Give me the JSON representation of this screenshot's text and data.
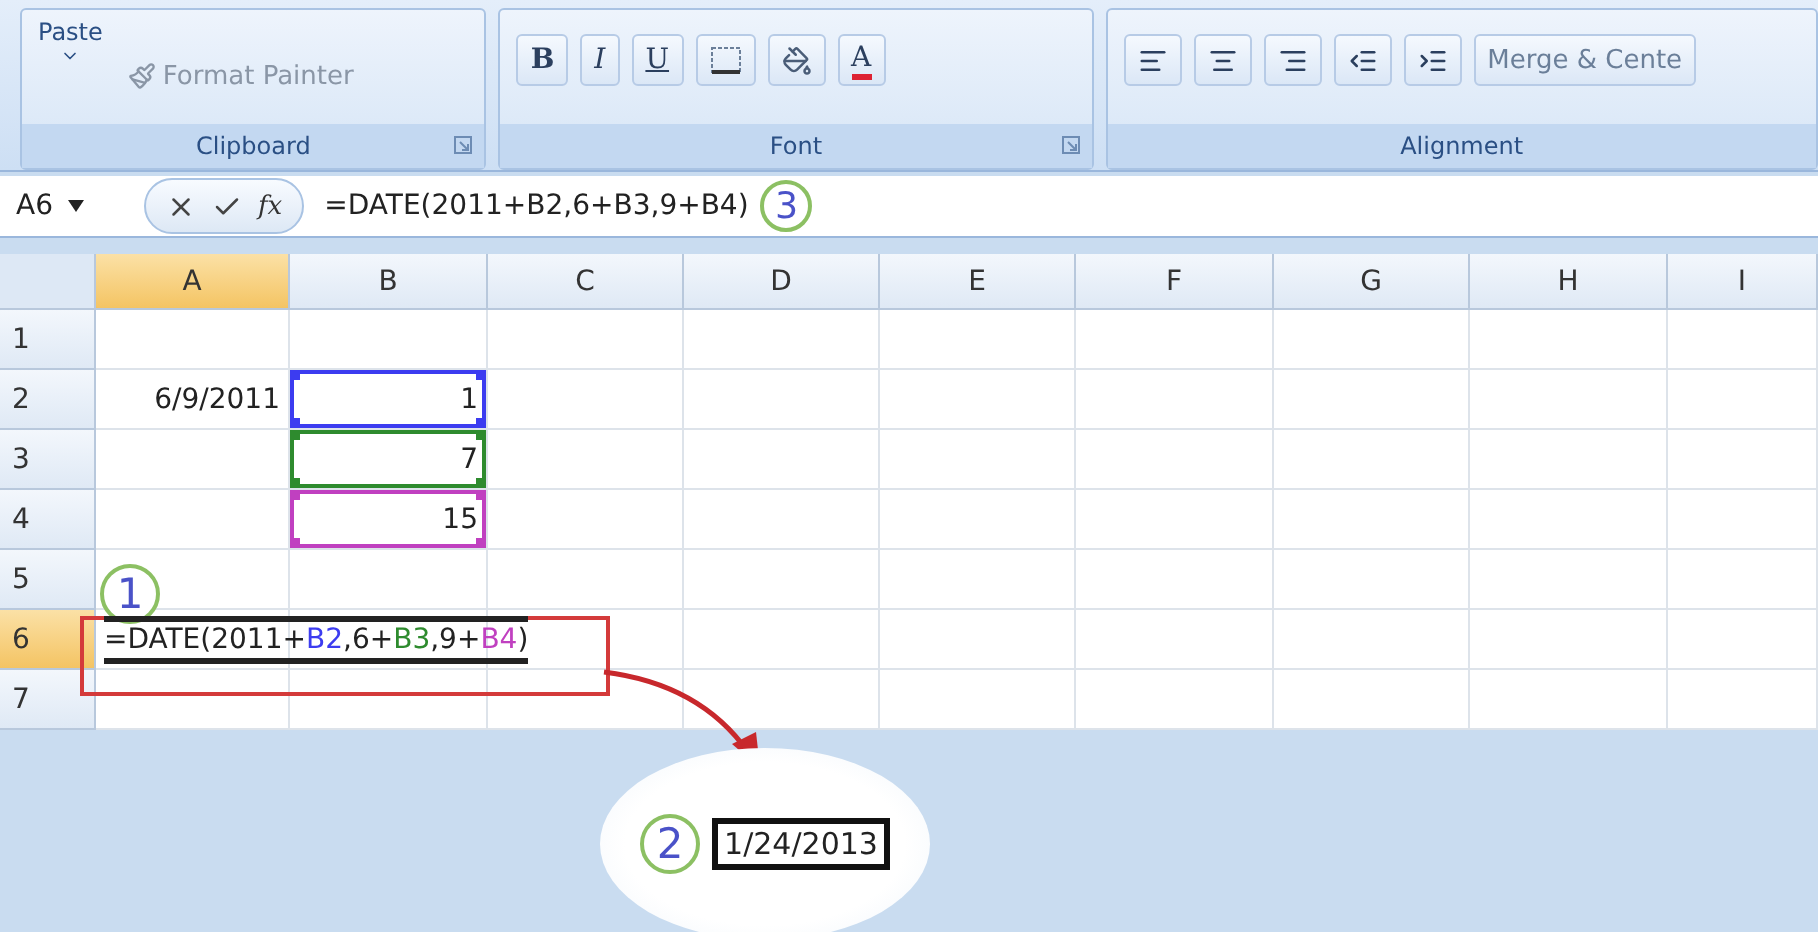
{
  "ribbon": {
    "groups": [
      {
        "label": "Clipboard",
        "kind": "clipboard",
        "paste": "Paste",
        "format_painter": "Format Painter"
      },
      {
        "label": "Font",
        "kind": "font",
        "bold": "B",
        "italic": "I",
        "underline": "U",
        "font_color": "A"
      },
      {
        "label": "Alignment",
        "kind": "alignment",
        "merge": "Merge & Cente"
      }
    ]
  },
  "formula_bar": {
    "name_box": "A6",
    "function_button": "fx",
    "formula": "=DATE(2011+B2,6+B3,9+B4)",
    "step": "3"
  },
  "columns": [
    {
      "label": "A",
      "selected": true
    },
    {
      "label": "B",
      "selected": false
    },
    {
      "label": "C",
      "selected": false
    },
    {
      "label": "D",
      "selected": false
    },
    {
      "label": "E",
      "selected": false
    },
    {
      "label": "F",
      "selected": false
    },
    {
      "label": "G",
      "selected": false
    },
    {
      "label": "H",
      "selected": false
    },
    {
      "label": "I",
      "selected": false
    }
  ],
  "rows": [
    {
      "header": "1",
      "selected": false,
      "cells": []
    },
    {
      "header": "2",
      "selected": false,
      "cells": [
        {
          "value": "6/9/2011"
        },
        {
          "value": "1",
          "color": "#3c3cf0"
        }
      ]
    },
    {
      "header": "3",
      "selected": false,
      "cells": [
        {},
        {
          "value": "7",
          "color": "#2e8b2e"
        }
      ]
    },
    {
      "header": "4",
      "selected": false,
      "cells": [
        {},
        {
          "value": "15",
          "color": "#c040c0"
        }
      ]
    },
    {
      "header": "5",
      "selected": false,
      "cells": []
    },
    {
      "header": "6",
      "selected": true,
      "cells": [
        {
          "editing": true,
          "parts": [
            {
              "text": "=DATE(2011+"
            },
            {
              "text": "B2",
              "color": "#3c3cf0"
            },
            {
              "text": ",6+"
            },
            {
              "text": "B3",
              "color": "#2e8b2e"
            },
            {
              "text": ",9+"
            },
            {
              "text": "B4",
              "color": "#c040c0"
            },
            {
              "text": ")"
            }
          ]
        }
      ]
    },
    {
      "header": "7",
      "selected": false,
      "cells": []
    }
  ],
  "step_one": "1",
  "result_callout": {
    "step": "2",
    "value": "1/24/2013"
  }
}
